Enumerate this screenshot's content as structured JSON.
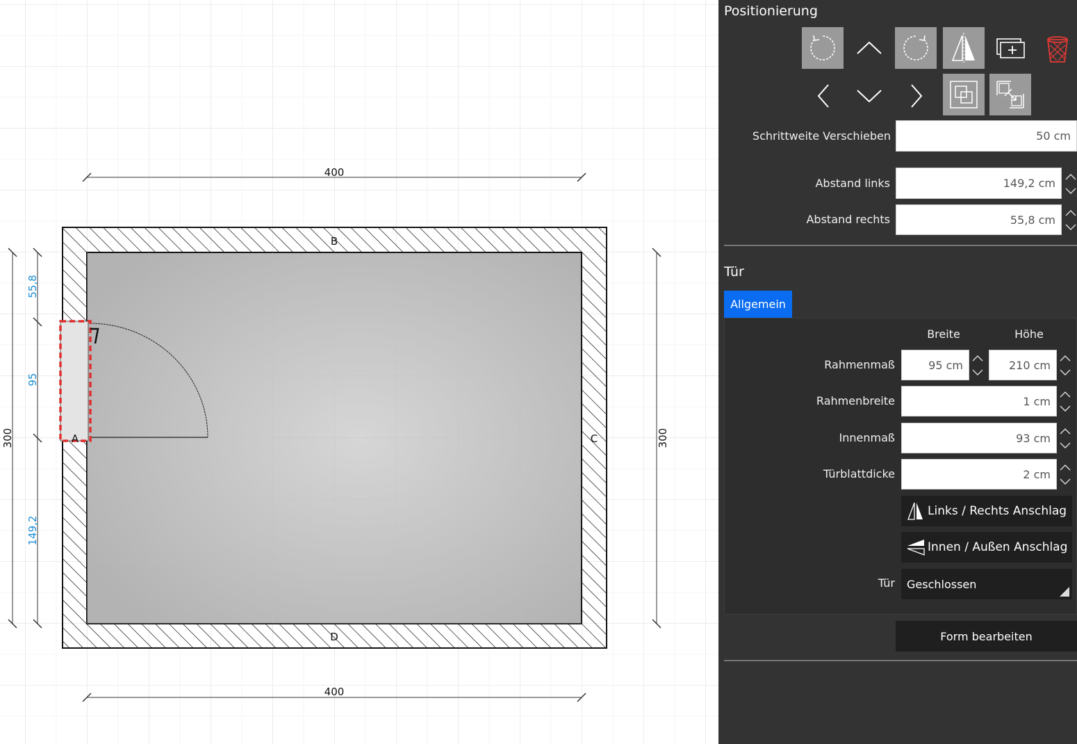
{
  "plan": {
    "dimension_top": "400",
    "dimension_bottom": "400",
    "dimension_left": "300",
    "dimension_right": "300",
    "wall_labels": {
      "a": "A",
      "b": "B",
      "c": "C",
      "d": "D"
    },
    "door_offsets": {
      "top": "55,8",
      "door": "95",
      "bottom": "149,2"
    },
    "colors": {
      "accent_blue": "#1f8fd6",
      "selection_red": "#e03030",
      "floor": "#c4c4c4"
    }
  },
  "panel": {
    "positioning_title": "Positionierung",
    "toolbar_icons": [
      "rotate-ccw-icon",
      "arrow-up-icon",
      "rotate-cw-icon",
      "mirror-icon",
      "duplicate-icon",
      "delete-icon",
      "arrow-left-icon",
      "arrow-down-icon",
      "arrow-right-icon",
      "snap-icon",
      "shrink-icon"
    ],
    "step_label": "Schrittweite Verschieben",
    "step_value": "50 cm",
    "dist_left_label": "Abstand links",
    "dist_left_value": "149,2 cm",
    "dist_right_label": "Abstand rechts",
    "dist_right_value": "55,8 cm",
    "door_title": "Tür",
    "tab_general": "Allgemein",
    "col_width": "Breite",
    "col_height": "Höhe",
    "frame_size_label": "Rahmenmaß",
    "frame_size_width": "95 cm",
    "frame_size_height": "210 cm",
    "frame_width_label": "Rahmenbreite",
    "frame_width_value": "1 cm",
    "inner_size_label": "Innenmaß",
    "inner_size_value": "93 cm",
    "leaf_thickness_label": "Türblattdicke",
    "leaf_thickness_value": "2 cm",
    "hinge_lr_button": "Links / Rechts Anschlag",
    "hinge_io_button": "Innen / Außen Anschlag",
    "door_state_label": "Tür",
    "door_state_value": "Geschlossen",
    "edit_shape_button": "Form bearbeiten",
    "tab_active_color": "#0a6cf0",
    "delete_color": "#e53935"
  }
}
